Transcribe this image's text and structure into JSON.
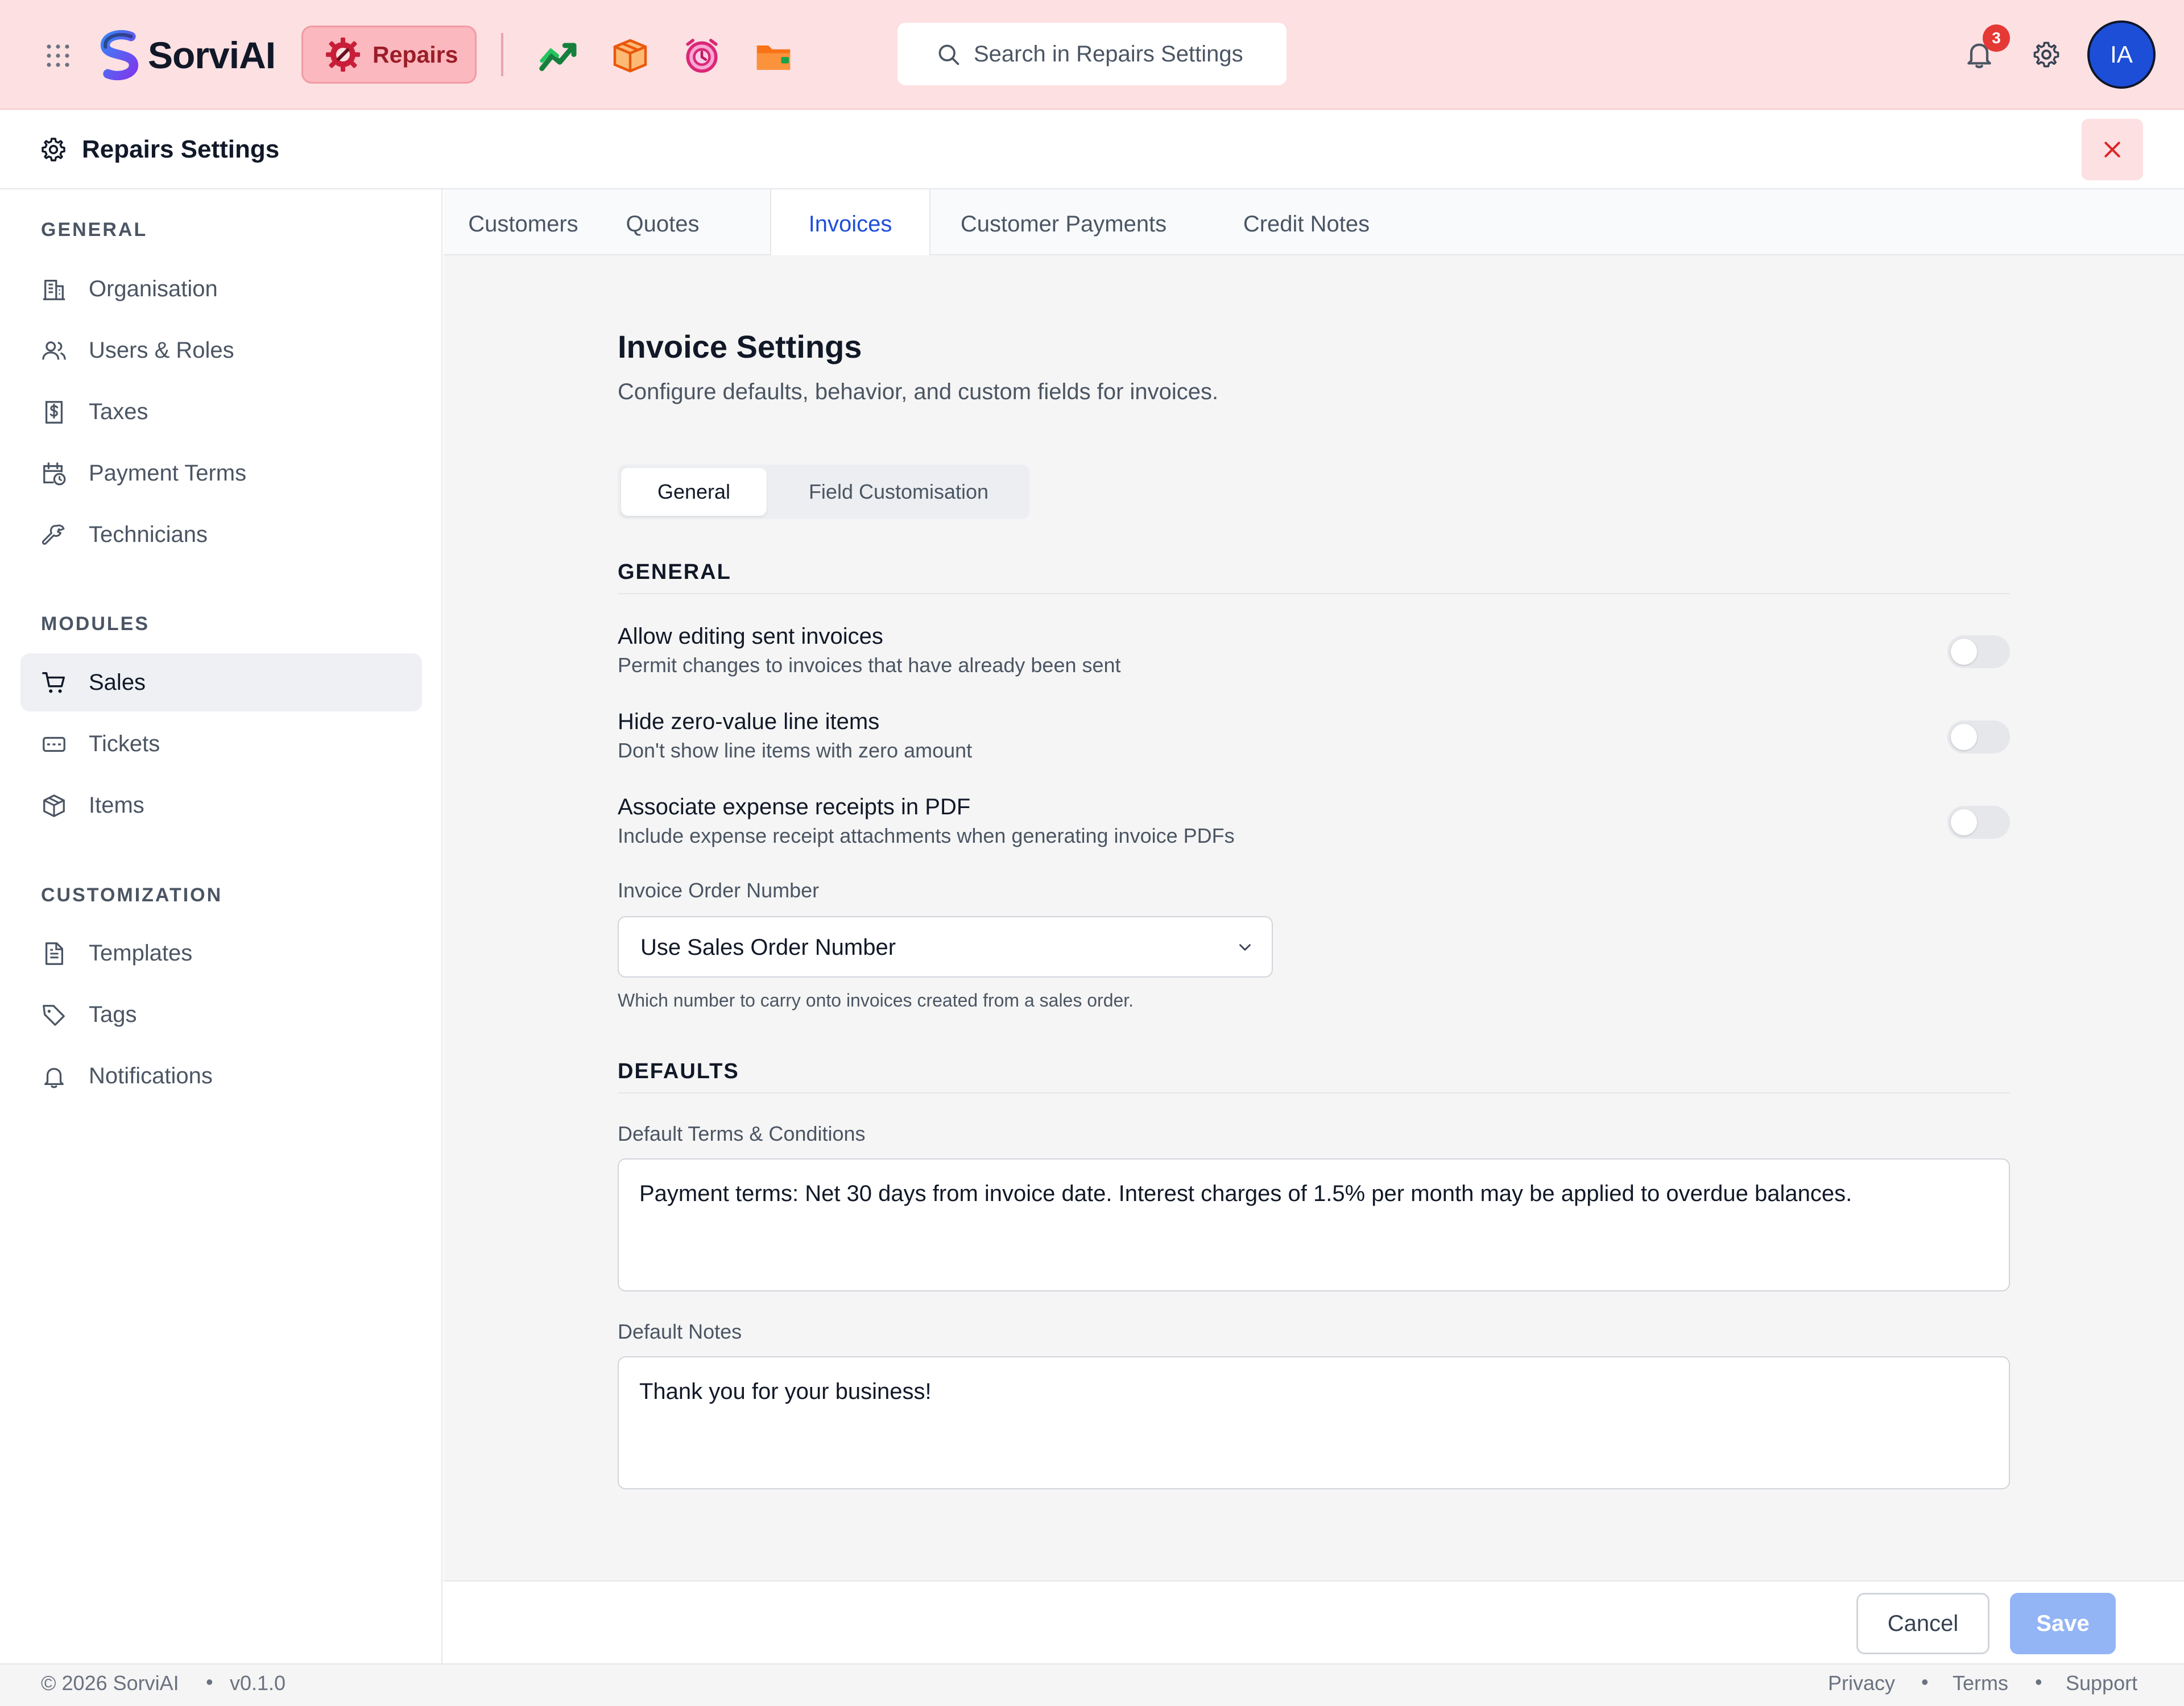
{
  "topbar": {
    "brand": "SorviAI",
    "module_label": "Repairs",
    "search_placeholder": "Search in Repairs Settings",
    "notification_count": "3",
    "avatar_initials": "IA",
    "icons": [
      "apps-grid-icon",
      "sorviai-logo",
      "repairs-gear-icon",
      "sales-chart-icon",
      "inventory-box-icon",
      "tickets-alarm-icon",
      "folder-icon",
      "bell-icon",
      "gear-icon"
    ]
  },
  "header": {
    "title": "Repairs Settings"
  },
  "sidebar": {
    "sections": [
      {
        "heading": "GENERAL",
        "items": [
          {
            "label": "Organisation",
            "icon": "building-icon"
          },
          {
            "label": "Users & Roles",
            "icon": "users-icon"
          },
          {
            "label": "Taxes",
            "icon": "dollar-receipt-icon"
          },
          {
            "label": "Payment Terms",
            "icon": "calendar-clock-icon"
          },
          {
            "label": "Technicians",
            "icon": "wrench-icon"
          }
        ]
      },
      {
        "heading": "MODULES",
        "items": [
          {
            "label": "Sales",
            "icon": "cart-icon",
            "active": true
          },
          {
            "label": "Tickets",
            "icon": "ticket-icon"
          },
          {
            "label": "Items",
            "icon": "package-icon"
          }
        ]
      },
      {
        "heading": "CUSTOMIZATION",
        "items": [
          {
            "label": "Templates",
            "icon": "document-icon"
          },
          {
            "label": "Tags",
            "icon": "tag-icon"
          },
          {
            "label": "Notifications",
            "icon": "bell-icon"
          }
        ]
      }
    ]
  },
  "tabs": [
    {
      "label": "Customers"
    },
    {
      "label": "Quotes"
    },
    {
      "label": "Invoices",
      "active": true
    },
    {
      "label": "Customer Payments"
    },
    {
      "label": "Credit Notes"
    }
  ],
  "main": {
    "title": "Invoice Settings",
    "subtitle": "Configure defaults, behavior, and custom fields for invoices.",
    "segments": [
      {
        "label": "General",
        "active": true
      },
      {
        "label": "Field Customisation"
      }
    ],
    "general_heading": "GENERAL",
    "settings": [
      {
        "title": "Allow editing sent invoices",
        "description": "Permit changes to invoices that have already been sent",
        "enabled": false
      },
      {
        "title": "Hide zero-value line items",
        "description": "Don't show line items with zero amount",
        "enabled": false
      },
      {
        "title": "Associate expense receipts in PDF",
        "description": "Include expense receipt attachments when generating invoice PDFs",
        "enabled": false
      }
    ],
    "order_number": {
      "label": "Invoice Order Number",
      "value": "Use Sales Order Number",
      "hint": "Which number to carry onto invoices created from a sales order."
    },
    "defaults_heading": "DEFAULTS",
    "terms": {
      "label": "Default Terms & Conditions",
      "value": "Payment terms: Net 30 days from invoice date. Interest charges of 1.5% per month may be applied to overdue balances."
    },
    "notes": {
      "label": "Default Notes",
      "value": "Thank you for your business!"
    }
  },
  "actions": {
    "cancel_label": "Cancel",
    "save_label": "Save"
  },
  "footer": {
    "copyright": "© 2026 SorviAI",
    "version": "v0.1.0",
    "links": [
      "Privacy",
      "Terms",
      "Support"
    ]
  },
  "colors": {
    "topbar_bg": "#fde0e2",
    "module_pill": "#fbb8be",
    "accent_blue": "#1d4ed8",
    "save_disabled": "#93b4f5"
  }
}
